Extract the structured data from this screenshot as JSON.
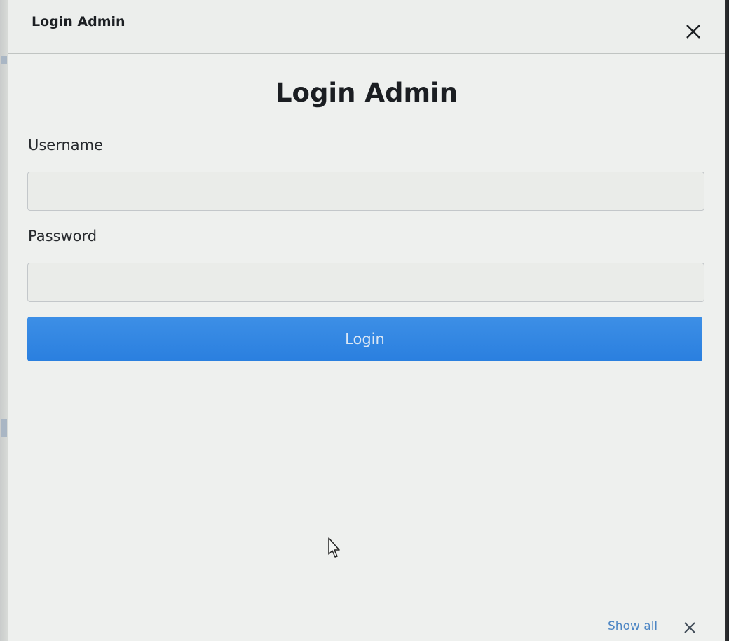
{
  "window": {
    "title": "Login Admin",
    "close_icon": "close-icon"
  },
  "form": {
    "heading": "Login Admin",
    "username_label": "Username",
    "username_value": "",
    "password_label": "Password",
    "password_value": "",
    "login_button": "Login"
  },
  "notification_bar": {
    "show_all": "Show all",
    "close_icon": "close-icon"
  },
  "colors": {
    "primary_button": "#2f84e2",
    "link": "#4d86c4",
    "background": "#eef0ee"
  }
}
